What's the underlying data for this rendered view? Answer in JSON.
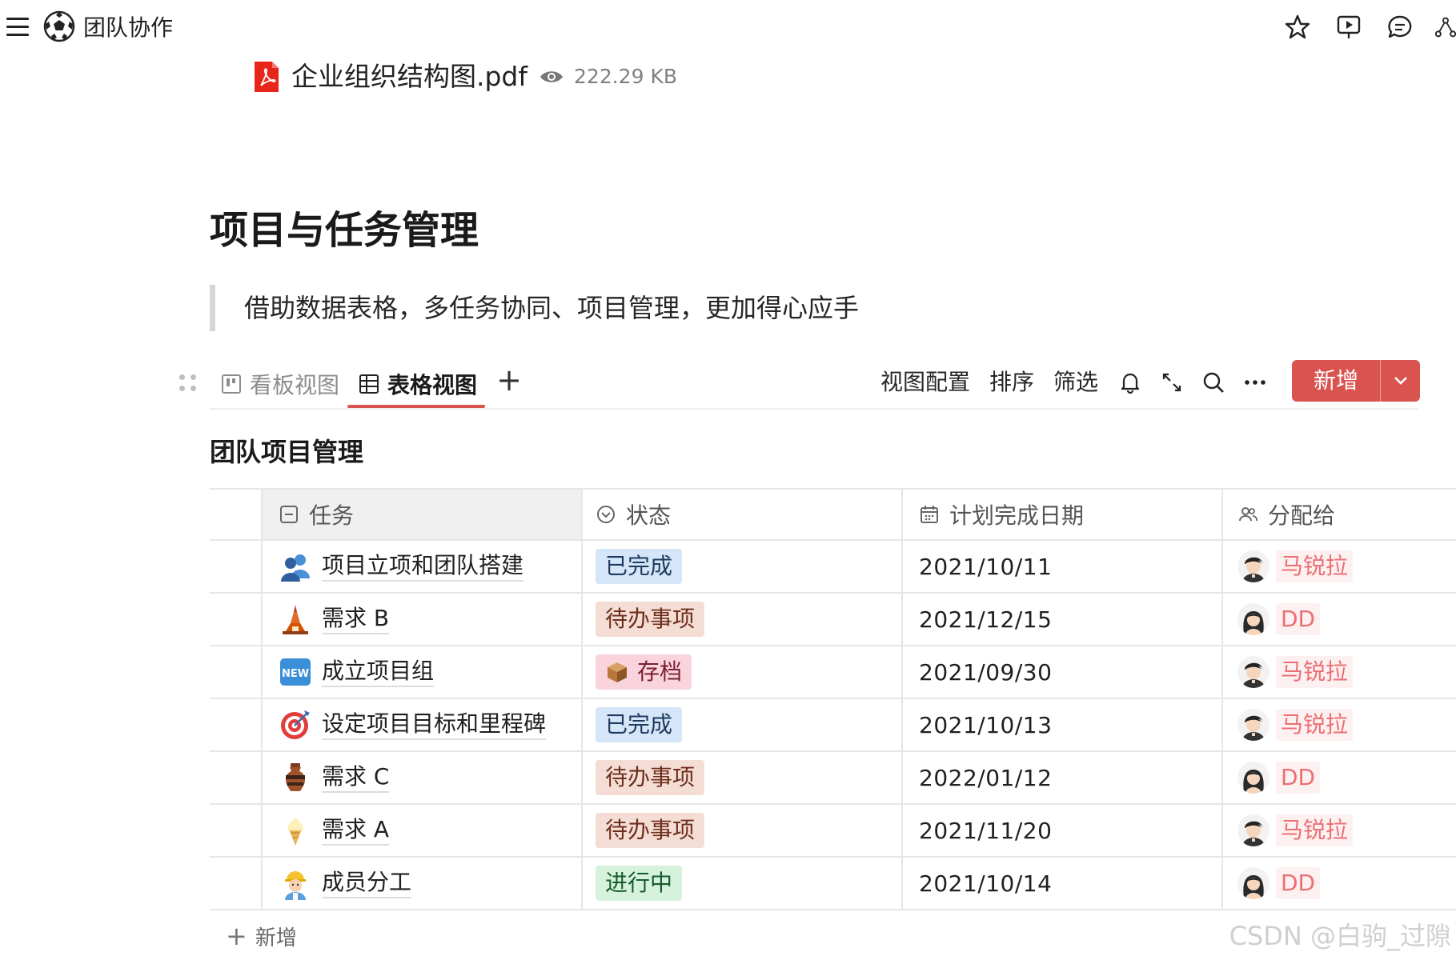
{
  "app": {
    "title": "团队协作"
  },
  "attachment": {
    "name": "企业组织结构图.pdf",
    "size": "222.29 KB"
  },
  "page": {
    "title": "项目与任务管理",
    "quote": "借助数据表格，多任务协同、项目管理，更加得心应手"
  },
  "views": {
    "tabs": [
      {
        "label": "看板视图",
        "active": false
      },
      {
        "label": "表格视图",
        "active": true
      }
    ],
    "add_view": "+",
    "accent": "#d9534f"
  },
  "toolbar": {
    "config": "视图配置",
    "sort": "排序",
    "filter": "筛选",
    "new_label": "新增"
  },
  "table": {
    "title": "团队项目管理",
    "columns": [
      {
        "label": "任务",
        "icon": "text-field-icon"
      },
      {
        "label": "状态",
        "icon": "status-icon"
      },
      {
        "label": "计划完成日期",
        "icon": "calendar-icon"
      },
      {
        "label": "分配给",
        "icon": "people-icon"
      }
    ],
    "rows": [
      {
        "task": "项目立项和团队搭建",
        "icon": "people-emoji",
        "status": "已完成",
        "status_kind": "done",
        "date": "2021/10/11",
        "assignee": "马锐拉",
        "avatar": "male"
      },
      {
        "task": "需求 B",
        "icon": "tower-emoji",
        "status": "待办事项",
        "status_kind": "todo",
        "date": "2021/12/15",
        "assignee": "DD",
        "avatar": "female"
      },
      {
        "task": "成立项目组",
        "icon": "new-emoji",
        "status": "存档",
        "status_kind": "archive",
        "date": "2021/09/30",
        "assignee": "马锐拉",
        "avatar": "male"
      },
      {
        "task": "设定项目目标和里程碑",
        "icon": "target-emoji",
        "status": "已完成",
        "status_kind": "done",
        "date": "2021/10/13",
        "assignee": "马锐拉",
        "avatar": "male"
      },
      {
        "task": "需求 C",
        "icon": "vase-emoji",
        "status": "待办事项",
        "status_kind": "todo",
        "date": "2022/01/12",
        "assignee": "DD",
        "avatar": "female"
      },
      {
        "task": "需求 A",
        "icon": "icecream-emoji",
        "status": "待办事项",
        "status_kind": "todo",
        "date": "2021/11/20",
        "assignee": "马锐拉",
        "avatar": "male"
      },
      {
        "task": "成员分工",
        "icon": "worker-emoji",
        "status": "进行中",
        "status_kind": "progress",
        "date": "2021/10/14",
        "assignee": "DD",
        "avatar": "female"
      }
    ],
    "add_row": "新增"
  },
  "watermark": "CSDN @白驹_过隙"
}
